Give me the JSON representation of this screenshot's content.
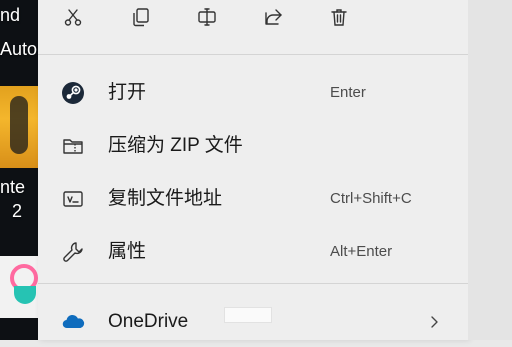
{
  "desktop": {
    "texts": [
      "nd",
      "Auto",
      "nte",
      "2"
    ]
  },
  "toolbar": {
    "buttons": [
      {
        "name": "cut",
        "icon": "scissors-icon"
      },
      {
        "name": "copy",
        "icon": "copy-icon"
      },
      {
        "name": "rename",
        "icon": "rename-icon"
      },
      {
        "name": "share",
        "icon": "share-icon"
      },
      {
        "name": "delete",
        "icon": "trash-icon"
      }
    ]
  },
  "menu": {
    "items": [
      {
        "label": "打开",
        "shortcut": "Enter",
        "icon": "steam-icon"
      },
      {
        "label": "压缩为 ZIP 文件",
        "shortcut": "",
        "icon": "zip-folder-icon"
      },
      {
        "label": "复制文件地址",
        "shortcut": "Ctrl+Shift+C",
        "icon": "copy-path-icon"
      },
      {
        "label": "属性",
        "shortcut": "Alt+Enter",
        "icon": "wrench-icon"
      },
      {
        "label": "OneDrive",
        "shortcut": "",
        "icon": "onedrive-cloud-icon",
        "has_submenu": true
      }
    ]
  },
  "colors": {
    "menu_bg": "#eeeeee",
    "text": "#1a1a1a",
    "shortcut_text": "#4c4c4c",
    "onedrive_blue": "#0f6cbd",
    "steam_dark": "#1b2838"
  }
}
